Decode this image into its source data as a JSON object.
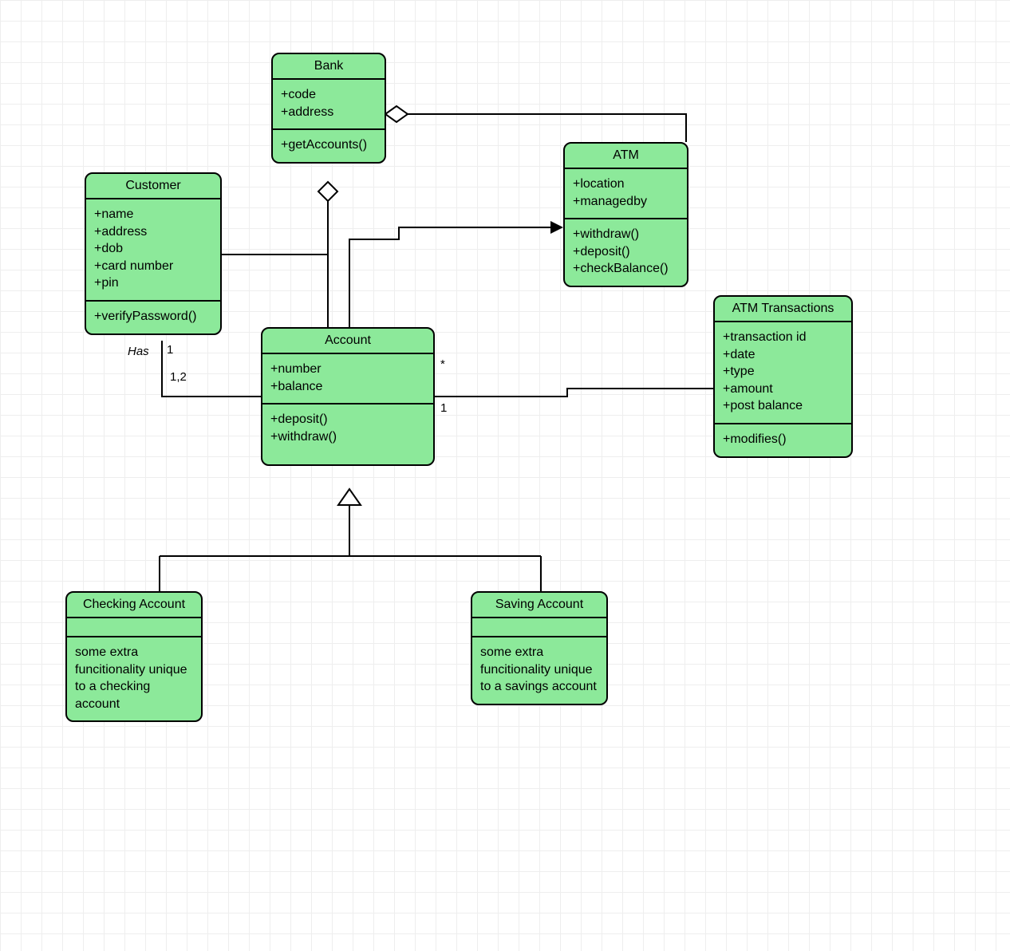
{
  "classes": {
    "bank": {
      "title": "Bank",
      "attributes": "+code\n+address",
      "methods": "+getAccounts()"
    },
    "customer": {
      "title": "Customer",
      "attributes": "+name\n+address\n+dob\n+card number\n+pin",
      "methods": "+verifyPassword()"
    },
    "atm": {
      "title": "ATM",
      "attributes": "+location\n+managedby",
      "methods": "+withdraw()\n+deposit()\n+checkBalance()"
    },
    "account": {
      "title": "Account",
      "attributes": "+number\n+balance",
      "methods": "+deposit()\n+withdraw()"
    },
    "atm_transactions": {
      "title": "ATM Transactions",
      "attributes": "+transaction id\n+date\n+type\n+amount\n+post balance",
      "methods": "+modifies()"
    },
    "checking": {
      "title": "Checking Account",
      "attributes": "",
      "methods": "some extra funcitionality unique to a checking account"
    },
    "saving": {
      "title": "Saving Account",
      "attributes": "",
      "methods": "some extra funcitionality unique to a savings account"
    }
  },
  "labels": {
    "has": "Has",
    "one_left": "1",
    "one_comma_two": "1,2",
    "star": "*",
    "one_right": "1"
  }
}
